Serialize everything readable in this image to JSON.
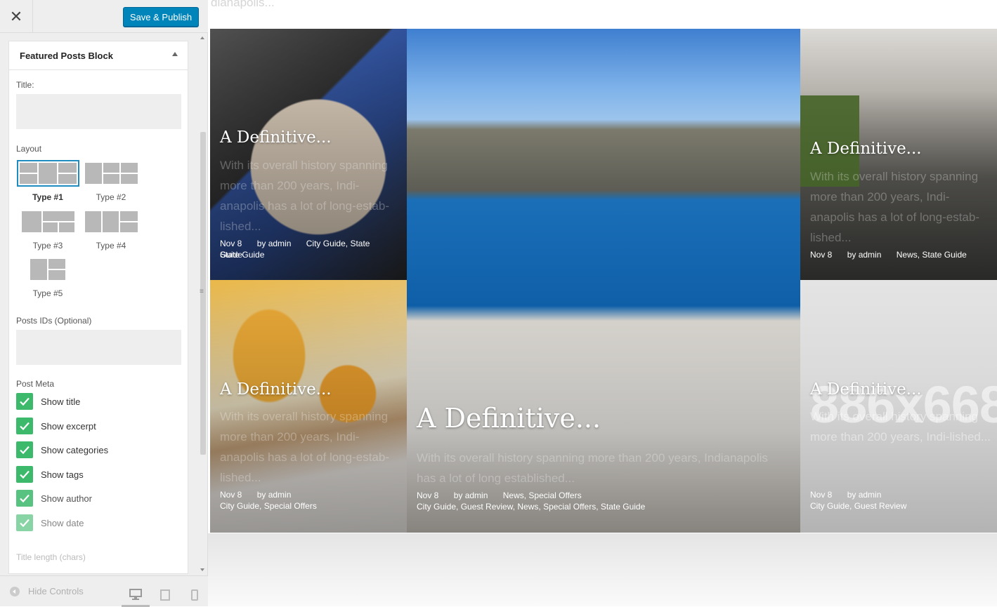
{
  "sidebar": {
    "close_icon": "close-icon",
    "publish_label": "Save & Publish",
    "section_title": "Featured Posts Block",
    "fields": {
      "title_label": "Title:",
      "title_value": "",
      "layout_label": "Layout",
      "posts_ids_label": "Posts IDs (Optional)",
      "posts_ids_value": "",
      "post_meta_label": "Post Meta",
      "title_length_label": "Title length (chars)"
    },
    "layouts": [
      {
        "name": "Type #1",
        "selected": true
      },
      {
        "name": "Type #2",
        "selected": false
      },
      {
        "name": "Type #3",
        "selected": false
      },
      {
        "name": "Type #4",
        "selected": false
      },
      {
        "name": "Type #5",
        "selected": false
      }
    ],
    "checkboxes": [
      {
        "label": "Show title",
        "checked": true
      },
      {
        "label": "Show excerpt",
        "checked": true
      },
      {
        "label": "Show categories",
        "checked": true
      },
      {
        "label": "Show tags",
        "checked": true
      },
      {
        "label": "Show author",
        "checked": true
      },
      {
        "label": "Show date",
        "checked": true
      }
    ],
    "footer": {
      "hide_controls_label": "Hide Controls",
      "devices": [
        "desktop-icon",
        "tablet-icon",
        "mobile-icon"
      ]
    },
    "accent_color": "#0085ba",
    "check_color": "#3cb96b"
  },
  "preview": {
    "top_text": "dianapolis...",
    "cards": [
      {
        "title": "A Definitive...",
        "excerpt": "With its overall history spanning more than 200 years, Indi-anapolis has a lot of long-estab-lished...",
        "date": "Nov 8",
        "author": "by admin",
        "categories_inline": "City Guide, State Guide",
        "categories_line": "State Guide"
      },
      {
        "title": "A Definitive...",
        "excerpt": "With its overall history spanning more than 200 years, Indi-anapolis has a lot of long-estab-lished...",
        "date": "Nov 8",
        "author": "by admin",
        "categories_inline": "News, State Guide",
        "categories_line": ""
      },
      {
        "title": "A Definitive...",
        "excerpt": "With its overall history spanning more than 200 years, Indi-anapolis has a lot of long-estab-lished...",
        "date": "Nov 8",
        "author": "by admin",
        "categories_inline": "",
        "categories_line": "City Guide, Special Offers"
      },
      {
        "title": "A Definitive...",
        "excerpt": "With its overall history spanning more than 200 years, Indianapolis has a lot of long established...",
        "date": "Nov 8",
        "author": "by admin",
        "categories_inline": "News, Special Offers",
        "categories_line": "City Guide, Guest Review, News, Special Offers, State Guide"
      },
      {
        "title": "A Definitive...",
        "excerpt": "With its overall history spanning more than 200 years, Indi-lished...",
        "date": "Nov 8",
        "author": "by admin",
        "categories_inline": "",
        "categories_line": "City Guide, Guest Review",
        "watermark": "886x668"
      }
    ]
  }
}
